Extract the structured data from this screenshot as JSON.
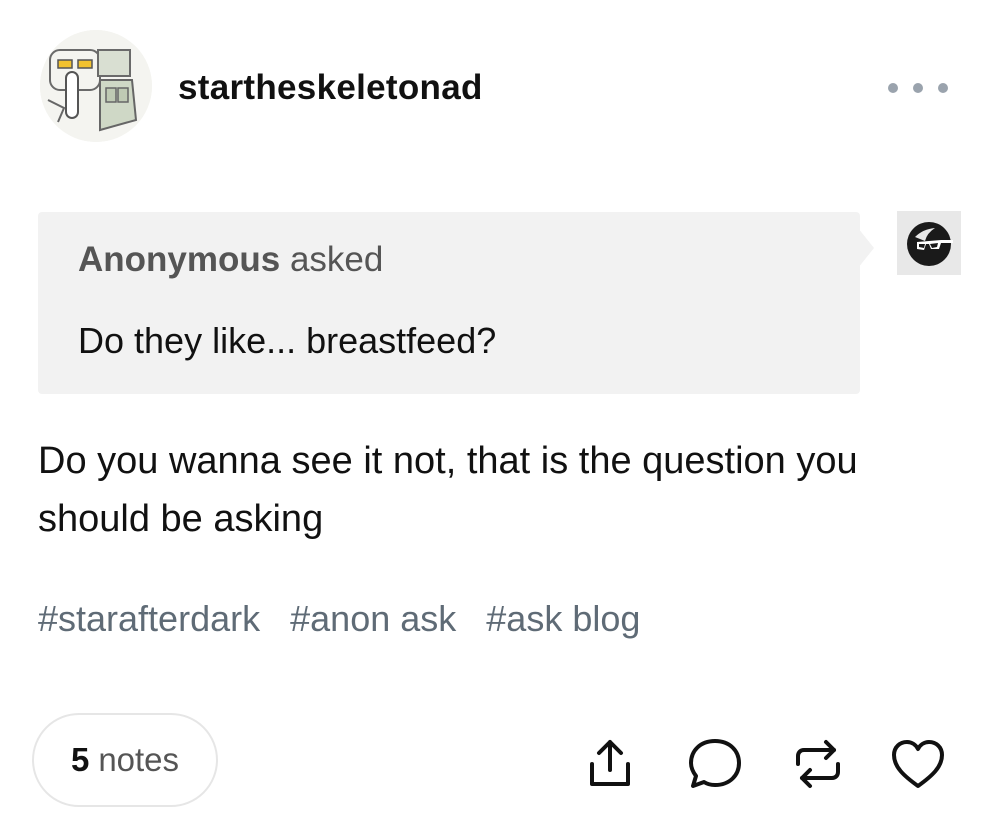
{
  "post": {
    "username": "startheskeletonad",
    "ask": {
      "asker": "Anonymous",
      "verb": "asked",
      "question": "Do they like... breastfeed?"
    },
    "answer": "Do you wanna see it not, that is the question you should be asking",
    "tags": [
      "#starafterdark",
      "#anon ask",
      "#ask blog"
    ],
    "notes": {
      "count": "5",
      "label": "notes"
    }
  },
  "icons": {
    "more": "more-dots-icon",
    "share": "share-icon",
    "reply": "reply-icon",
    "reblog": "reblog-icon",
    "like": "heart-icon"
  },
  "colors": {
    "ask_background": "#f2f2f2",
    "tag_text": "#5f6b76",
    "icon_stroke": "#111111"
  }
}
